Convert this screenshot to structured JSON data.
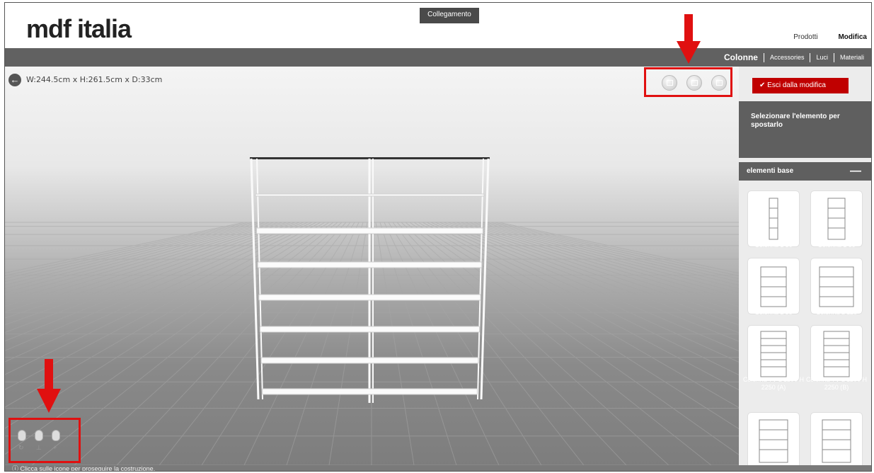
{
  "header": {
    "logo": "mdf italia",
    "collegamento": "Collegamento",
    "nav": [
      "Prodotti",
      "Modifica"
    ]
  },
  "subnav": {
    "current": "Colonne",
    "items": [
      "Accessories",
      "Luci",
      "Materiali"
    ]
  },
  "viewport": {
    "back_icon": "arrow-left-icon",
    "dimensions": "W:244.5cm x H:261.5cm x D:33cm",
    "view_buttons": [
      "front-view-icon",
      "side-view-icon",
      "3d-view-icon"
    ],
    "mouse_icons": [
      "rotate-mouse-icon",
      "tilt-mouse-icon",
      "pan-mouse-icon"
    ]
  },
  "panel": {
    "exit_button": "✔ Esci dalla modifica",
    "hint": "Selezionare l'elemento per spostarlo",
    "category": "elementi base",
    "collapse_symbol": "—",
    "items": [
      "Colonna L 30",
      "Colonna L 60",
      "Colonna L 90",
      "Colonna L 120",
      "Colonna TV L 1200 H 2250 (A)",
      "Colonna TV L 1200 H 2250 (B)"
    ]
  },
  "status": "ⓘ  Clicca sulle icone per proseguire la costruzione.",
  "colors": {
    "accent": "#c00000",
    "annotation": "#e01010",
    "bar": "#616161"
  }
}
